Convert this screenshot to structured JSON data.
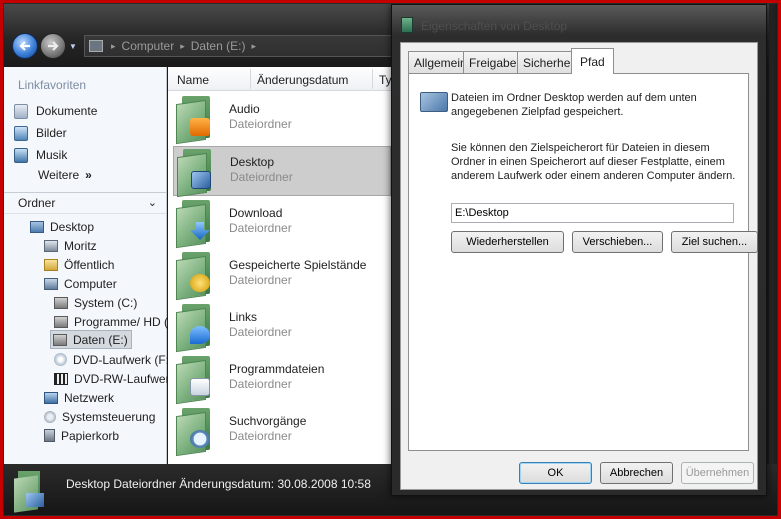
{
  "explorer": {
    "address": {
      "crumbs": [
        "Computer",
        "Daten (E:)"
      ]
    },
    "columns": {
      "name": "Name",
      "date": "Änderungsdatum",
      "type": "Typ"
    },
    "favorites": {
      "heading": "Linkfavoriten",
      "items": [
        "Dokumente",
        "Bilder",
        "Musik"
      ],
      "more": "Weitere",
      "more_arrow": "»"
    },
    "folders": {
      "heading": "Ordner",
      "tree": [
        "Desktop",
        "Moritz",
        "Öffentlich",
        "Computer",
        "System (C:)",
        "Programme/ HD (",
        "Daten (E:)",
        "DVD-Laufwerk (F:)",
        "DVD-RW-Laufwer",
        "Netzwerk",
        "Systemsteuerung",
        "Papierkorb"
      ]
    },
    "files": [
      {
        "name": "Audio",
        "type": "Dateiordner"
      },
      {
        "name": "Desktop",
        "type": "Dateiordner"
      },
      {
        "name": "Download",
        "type": "Dateiordner"
      },
      {
        "name": "Gespeicherte Spielstände",
        "type": "Dateiordner"
      },
      {
        "name": "Links",
        "type": "Dateiordner"
      },
      {
        "name": "Programmdateien",
        "type": "Dateiordner"
      },
      {
        "name": "Suchvorgänge",
        "type": "Dateiordner"
      }
    ],
    "status": "Desktop Dateiordner  Änderungsdatum: 30.08.2008 10:58"
  },
  "dialog": {
    "title": "Eigenschaften von Desktop",
    "tabs": [
      "Allgemein",
      "Freigabe",
      "Sicherheit",
      "Pfad"
    ],
    "active_tab": "Pfad",
    "description": "Dateien im Ordner Desktop werden auf dem unten angegebenen Zielpfad gespeichert.",
    "instructions": "Sie können den Zielspeicherort für Dateien in diesem Ordner in einen Speicherort auf dieser Festplatte, einem anderem Laufwerk oder einem anderen Computer ändern.",
    "path_value": "E:\\Desktop",
    "buttons": {
      "restore": "Wiederherstellen",
      "move": "Verschieben...",
      "find_target": "Ziel suchen...",
      "ok": "OK",
      "cancel": "Abbrechen",
      "apply": "Übernehmen"
    }
  },
  "icons": {
    "back": "arrow-left-icon",
    "forward": "arrow-right-icon",
    "folder": "folder-icon",
    "drive": "drive-icon"
  },
  "colors": {
    "accent": "#3b7fd8",
    "outer_border": "#c40000",
    "selection": "#cdcdcd"
  }
}
